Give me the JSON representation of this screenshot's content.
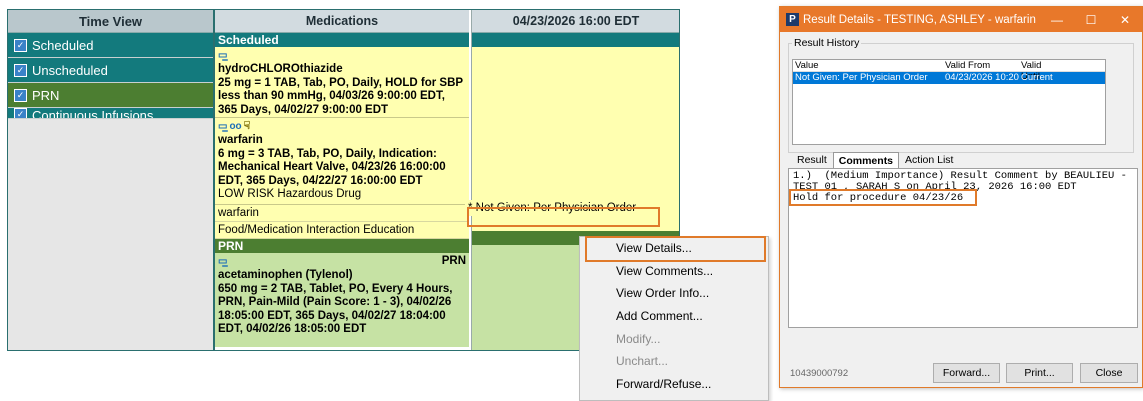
{
  "mar": {
    "timeview": {
      "header": "Time View",
      "items": [
        {
          "label": "Scheduled",
          "checked": true
        },
        {
          "label": "Unscheduled",
          "checked": true
        },
        {
          "label": "PRN",
          "checked": true
        },
        {
          "label": "Continuous Infusions",
          "checked": true
        }
      ]
    },
    "columns": {
      "medications": "Medications",
      "time": "04/23/2026 16:00 EDT"
    },
    "sections": {
      "scheduled": "Scheduled",
      "prn": "PRN"
    },
    "meds": {
      "hctz": {
        "name": "hydroCHLOROthiazide",
        "detail": "25 mg = 1 TAB, Tab, PO, Daily, HOLD for SBP less than 90 mmHg, 04/03/26 9:00:00 EDT, 365 Days, 04/02/27 9:00:00 EDT"
      },
      "warfarin": {
        "name": "warfarin",
        "detail": "6 mg = 3 TAB, Tab, PO, Daily, Indication: Mechanical Heart Valve, 04/23/26 16:00:00 EDT, 365 Days, 04/22/27 16:00:00 EDT",
        "hazard": "LOW RISK Hazardous Drug",
        "sub1": "warfarin",
        "sub2": "Food/Medication Interaction Education",
        "result": "* Not Given: Per Physician Order"
      },
      "acetaminophen": {
        "prn_label": "PRN",
        "name": "acetaminophen (Tylenol)",
        "detail": "650 mg = 2 TAB, Tablet, PO, Every 4 Hours, PRN, Pain-Mild (Pain Score: 1 - 3), 04/02/26 18:05:00 EDT, 365 Days, 04/02/27 18:04:00 EDT, 04/02/26 18:05:00 EDT"
      }
    }
  },
  "context_menu": [
    {
      "label": "View Details...",
      "enabled": true
    },
    {
      "label": "View Comments...",
      "enabled": true
    },
    {
      "label": "View Order Info...",
      "enabled": true
    },
    {
      "label": "Add Comment...",
      "enabled": true
    },
    {
      "label": "Modify...",
      "enabled": false
    },
    {
      "label": "Unchart...",
      "enabled": false
    },
    {
      "label": "Forward/Refuse...",
      "enabled": true
    }
  ],
  "dialog": {
    "title": "Result Details - TESTING, ASHLEY - warfarin",
    "app_icon": "P",
    "controls": {
      "minimize": "—",
      "maximize": "☐",
      "close": "✕"
    },
    "history_label": "Result History",
    "history_headers": [
      "Value",
      "Valid From",
      "Valid Until"
    ],
    "history_rows": [
      {
        "value": "Not Given: Per Physician Order",
        "from": "04/23/2026 10:20 EDT",
        "until": "Current"
      }
    ],
    "tabs": [
      "Result",
      "Comments",
      "Action List"
    ],
    "active_tab": "Comments",
    "comment_lines": [
      "1.)  (Medium Importance) Result Comment by BEAULIEU -",
      "TEST 01 , SARAH S on April 23, 2026 16:00 EDT",
      "Hold for procedure 04/23/26"
    ],
    "footer_id": "10439000792",
    "buttons": {
      "forward": "Forward...",
      "print": "Print...",
      "close": "Close"
    }
  },
  "colors": {
    "highlight": "#e07a2a",
    "teal": "#137a7d",
    "green": "#4c7e31",
    "yellow": "#ffffb0"
  }
}
